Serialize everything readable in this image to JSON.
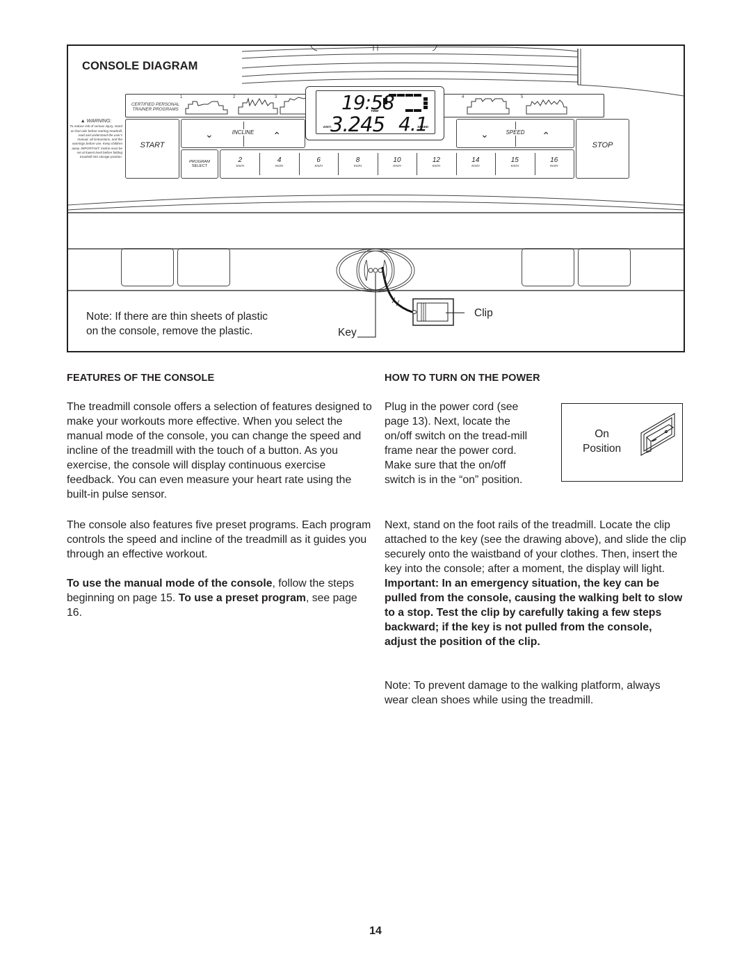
{
  "console_diagram": {
    "title": "CONSOLE DIAGRAM",
    "program_strip": {
      "label_line1": "CERTIFIED PERSONAL",
      "label_line2": "TRAINER PROGRAMS",
      "programs": [
        {
          "number": "1",
          "icon": "program-profile-icon"
        },
        {
          "number": "2",
          "icon": "program-profile-icon"
        },
        {
          "number": "3",
          "icon": "program-profile-icon"
        },
        {
          "number": "4",
          "icon": "program-profile-icon"
        },
        {
          "number": "5",
          "icon": "program-profile-icon"
        }
      ]
    },
    "display": {
      "time_value": "19:58",
      "time_label": "TIME",
      "distance_value": "3.245",
      "distance_label": "DIST.",
      "speed_value": "4.1",
      "speed_label": "SPEED"
    },
    "warning": {
      "title": "▲ WARNING:",
      "text": "To reduce risk of serious injury, stand on foot rails before starting treadmill, read and understand the user's manual, all instructions, and the warnings before use. Keep children away. IMPORTANT: Incline must be set at lowest level before folding treadmill into storage position."
    },
    "buttons": {
      "start": "START",
      "stop": "STOP",
      "incline": "INCLINE",
      "speed": "SPEED",
      "down_icon": "chevron-down-icon",
      "up_icon": "chevron-up-icon",
      "program_select_line1": "PROGRAM",
      "program_select_line2": "SELECT"
    },
    "speed_keys": [
      {
        "value": "2",
        "unit": "Km/H"
      },
      {
        "value": "4",
        "unit": "Km/H"
      },
      {
        "value": "6",
        "unit": "Km/H"
      },
      {
        "value": "8",
        "unit": "Km/H"
      },
      {
        "value": "10",
        "unit": "Km/H"
      },
      {
        "value": "12",
        "unit": "Km/H"
      },
      {
        "value": "14",
        "unit": "Km/H"
      },
      {
        "value": "15",
        "unit": "Km/H"
      },
      {
        "value": "16",
        "unit": "Km/H"
      }
    ],
    "note_line1": "Note: If there are thin sheets of plastic",
    "note_line2": "on the console, remove the plastic.",
    "key_label": "Key",
    "clip_label": "Clip"
  },
  "features": {
    "heading": "FEATURES OF THE CONSOLE",
    "p1": "The treadmill console offers a selection of features designed to make your workouts more effective. When you select the manual mode of the console, you can change the speed and incline of the treadmill with the touch of a button. As you exercise, the console will display continuous exercise feedback. You can even measure your heart rate using the built-in pulse sensor.",
    "p2": "The console also features five preset programs. Each program controls the speed and incline of the treadmill as it guides you through an effective workout.",
    "p3_bold1": "To use the manual mode of the console",
    "p3_text1": ", follow the steps beginning on page 15. ",
    "p3_bold2": "To use a preset program",
    "p3_text2": ", see page 16."
  },
  "power": {
    "heading": "HOW TO TURN ON THE POWER",
    "p1": "Plug in the power cord (see page 13). Next, locate the on/off switch on the tread-mill frame near the power cord. Make sure that the on/off switch is in the “on” position.",
    "switch_label_line1": "On",
    "switch_label_line2": "Position",
    "p2_text": "Next, stand on the foot rails of the treadmill. Locate the clip attached to the key (see the drawing above), and slide the clip securely onto the waistband of your clothes. Then, insert the key into the console; after a moment, the display will light. ",
    "p2_bold": "Important: In an emergency situation, the key can be pulled from the console, causing the walking belt to slow to a stop. Test the clip by carefully taking a few steps backward; if the key is not pulled from the console, adjust the position of the clip.",
    "p3": "Note: To prevent damage to the walking platform, always wear clean shoes while using the treadmill."
  },
  "page_number": "14"
}
